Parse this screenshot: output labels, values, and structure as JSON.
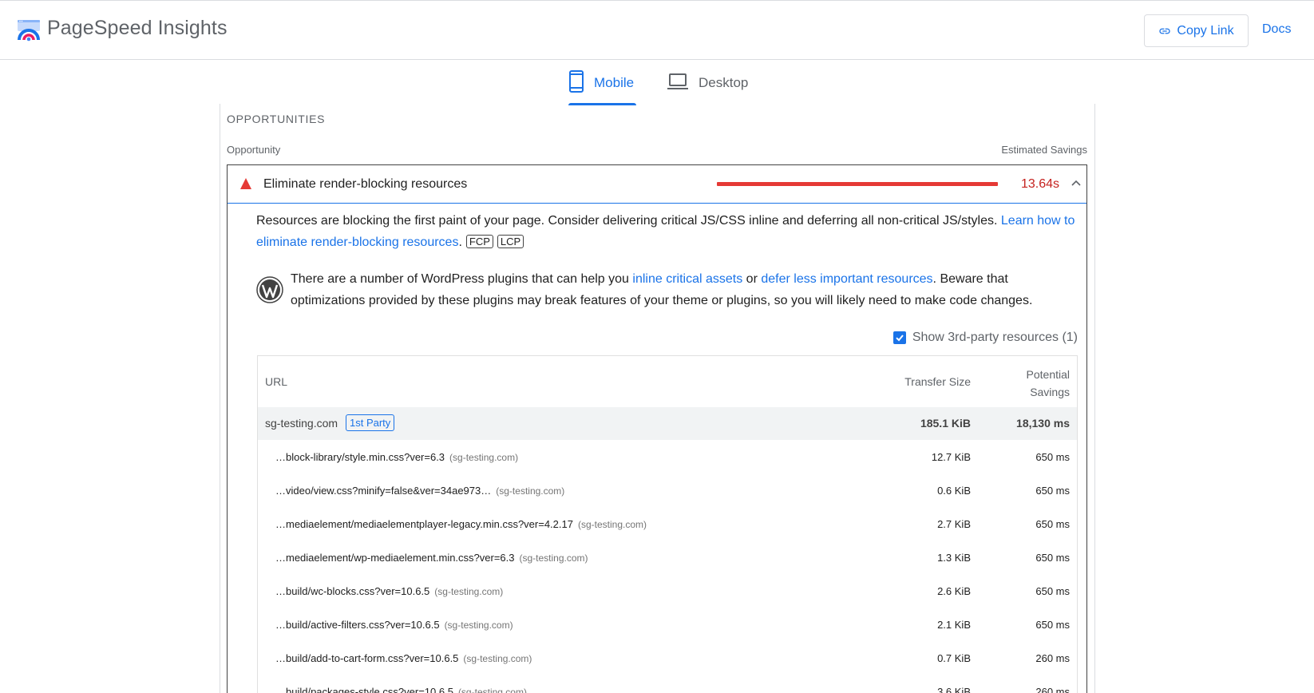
{
  "header": {
    "title": "PageSpeed Insights",
    "copy_link": "Copy Link",
    "docs": "Docs"
  },
  "tabs": [
    {
      "label": "Mobile",
      "active": true
    },
    {
      "label": "Desktop",
      "active": false
    }
  ],
  "section": {
    "title": "OPPORTUNITIES",
    "col_opportunity": "Opportunity",
    "col_savings": "Estimated Savings"
  },
  "audit": {
    "title": "Eliminate render-blocking resources",
    "savings": "13.64s",
    "severity_color": "#e53935",
    "desc_text": "Resources are blocking the first paint of your page. Consider delivering critical JS/CSS inline and deferring all non-critical JS/styles. ",
    "desc_link": "Learn how to eliminate render-blocking resources",
    "desc_end": ".",
    "tag_fcp": "FCP",
    "tag_lcp": "LCP",
    "wp_text1": "There are a number of WordPress plugins that can help you ",
    "wp_link1": "inline critical assets",
    "wp_text2": " or ",
    "wp_link2": "defer less important resources",
    "wp_text3": ". Beware that optimizations provided by these plugins may break features of your theme or plugins, so you will likely need to make code changes.",
    "third_party_label": "Show 3rd-party resources (1)",
    "third_party_checked": true
  },
  "table": {
    "col_url": "URL",
    "col_size": "Transfer Size",
    "col_savings_1": "Potential",
    "col_savings_2": "Savings",
    "group": {
      "name": "sg-testing.com",
      "badge": "1st Party",
      "size": "185.1 KiB",
      "savings": "18,130 ms"
    },
    "rows": [
      {
        "url": "…block-library/style.min.css?ver=6.3",
        "host": "(sg-testing.com)",
        "size": "12.7 KiB",
        "savings": "650 ms"
      },
      {
        "url": "…video/view.css?minify=false&ver=34ae973…",
        "host": "(sg-testing.com)",
        "size": "0.6 KiB",
        "savings": "650 ms"
      },
      {
        "url": "…mediaelement/mediaelementplayer-legacy.min.css?ver=4.2.17",
        "host": "(sg-testing.com)",
        "size": "2.7 KiB",
        "savings": "650 ms"
      },
      {
        "url": "…mediaelement/wp-mediaelement.min.css?ver=6.3",
        "host": "(sg-testing.com)",
        "size": "1.3 KiB",
        "savings": "650 ms"
      },
      {
        "url": "…build/wc-blocks.css?ver=10.6.5",
        "host": "(sg-testing.com)",
        "size": "2.6 KiB",
        "savings": "650 ms"
      },
      {
        "url": "…build/active-filters.css?ver=10.6.5",
        "host": "(sg-testing.com)",
        "size": "2.1 KiB",
        "savings": "650 ms"
      },
      {
        "url": "…build/add-to-cart-form.css?ver=10.6.5",
        "host": "(sg-testing.com)",
        "size": "0.7 KiB",
        "savings": "260 ms"
      },
      {
        "url": "…build/packages-style.css?ver=10.6.5",
        "host": "(sg-testing.com)",
        "size": "3.6 KiB",
        "savings": "260 ms"
      }
    ]
  }
}
